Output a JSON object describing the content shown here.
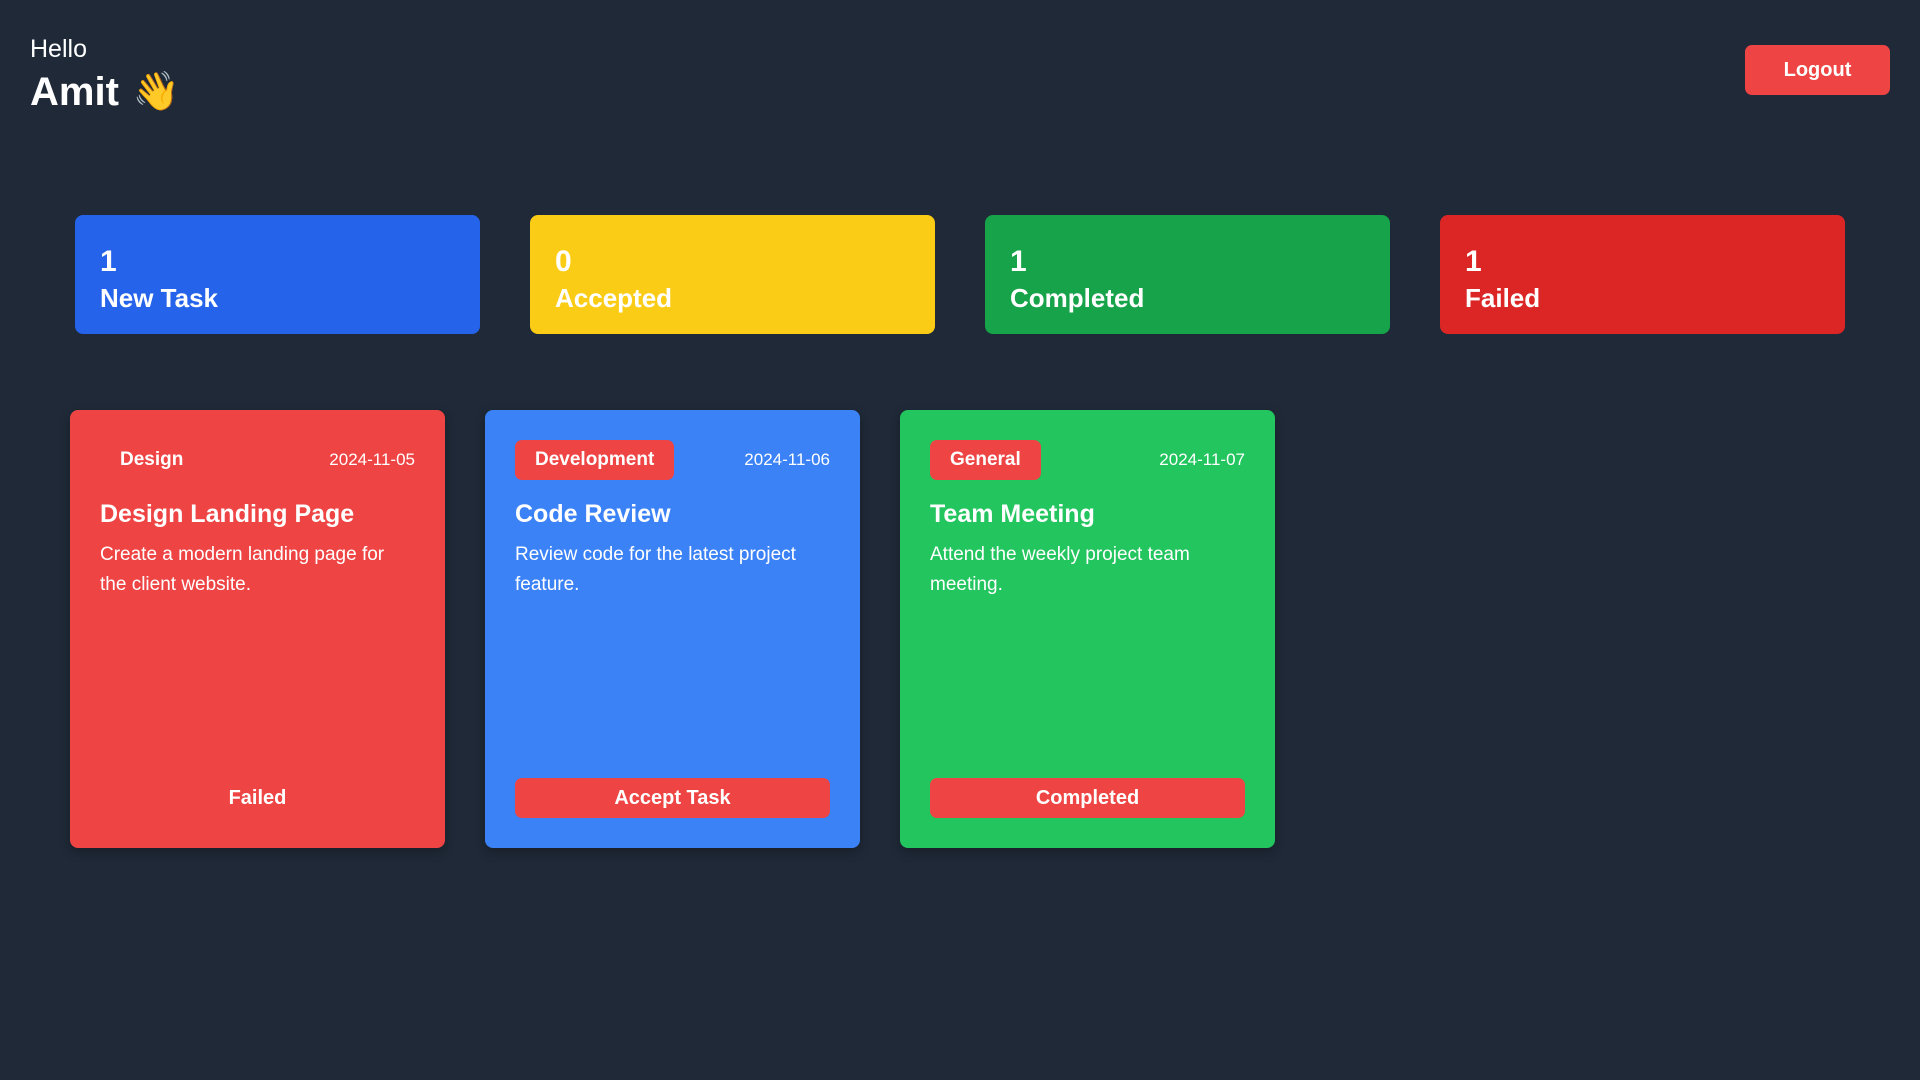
{
  "header": {
    "greeting": "Hello",
    "name": "Amit",
    "emoji": "👋",
    "logout_label": "Logout"
  },
  "stats": [
    {
      "count": "1",
      "label": "New Task",
      "color": "#2563eb"
    },
    {
      "count": "0",
      "label": "Accepted",
      "color": "#facc15"
    },
    {
      "count": "1",
      "label": "Completed",
      "color": "#16a34a"
    },
    {
      "count": "1",
      "label": "Failed",
      "color": "#dc2626"
    }
  ],
  "tasks": [
    {
      "category": "Design",
      "date": "2024-11-05",
      "title": "Design Landing Page",
      "description": "Create a modern landing page for the client website.",
      "action": "Failed",
      "color": "#ef4444"
    },
    {
      "category": "Development",
      "date": "2024-11-06",
      "title": "Code Review",
      "description": "Review code for the latest project feature.",
      "action": "Accept Task",
      "color": "#3b82f6"
    },
    {
      "category": "General",
      "date": "2024-11-07",
      "title": "Team Meeting",
      "description": "Attend the weekly project team meeting.",
      "action": "Completed",
      "color": "#22c55e"
    }
  ],
  "colors": {
    "background": "#1f2937",
    "accent_red": "#ef4444"
  }
}
